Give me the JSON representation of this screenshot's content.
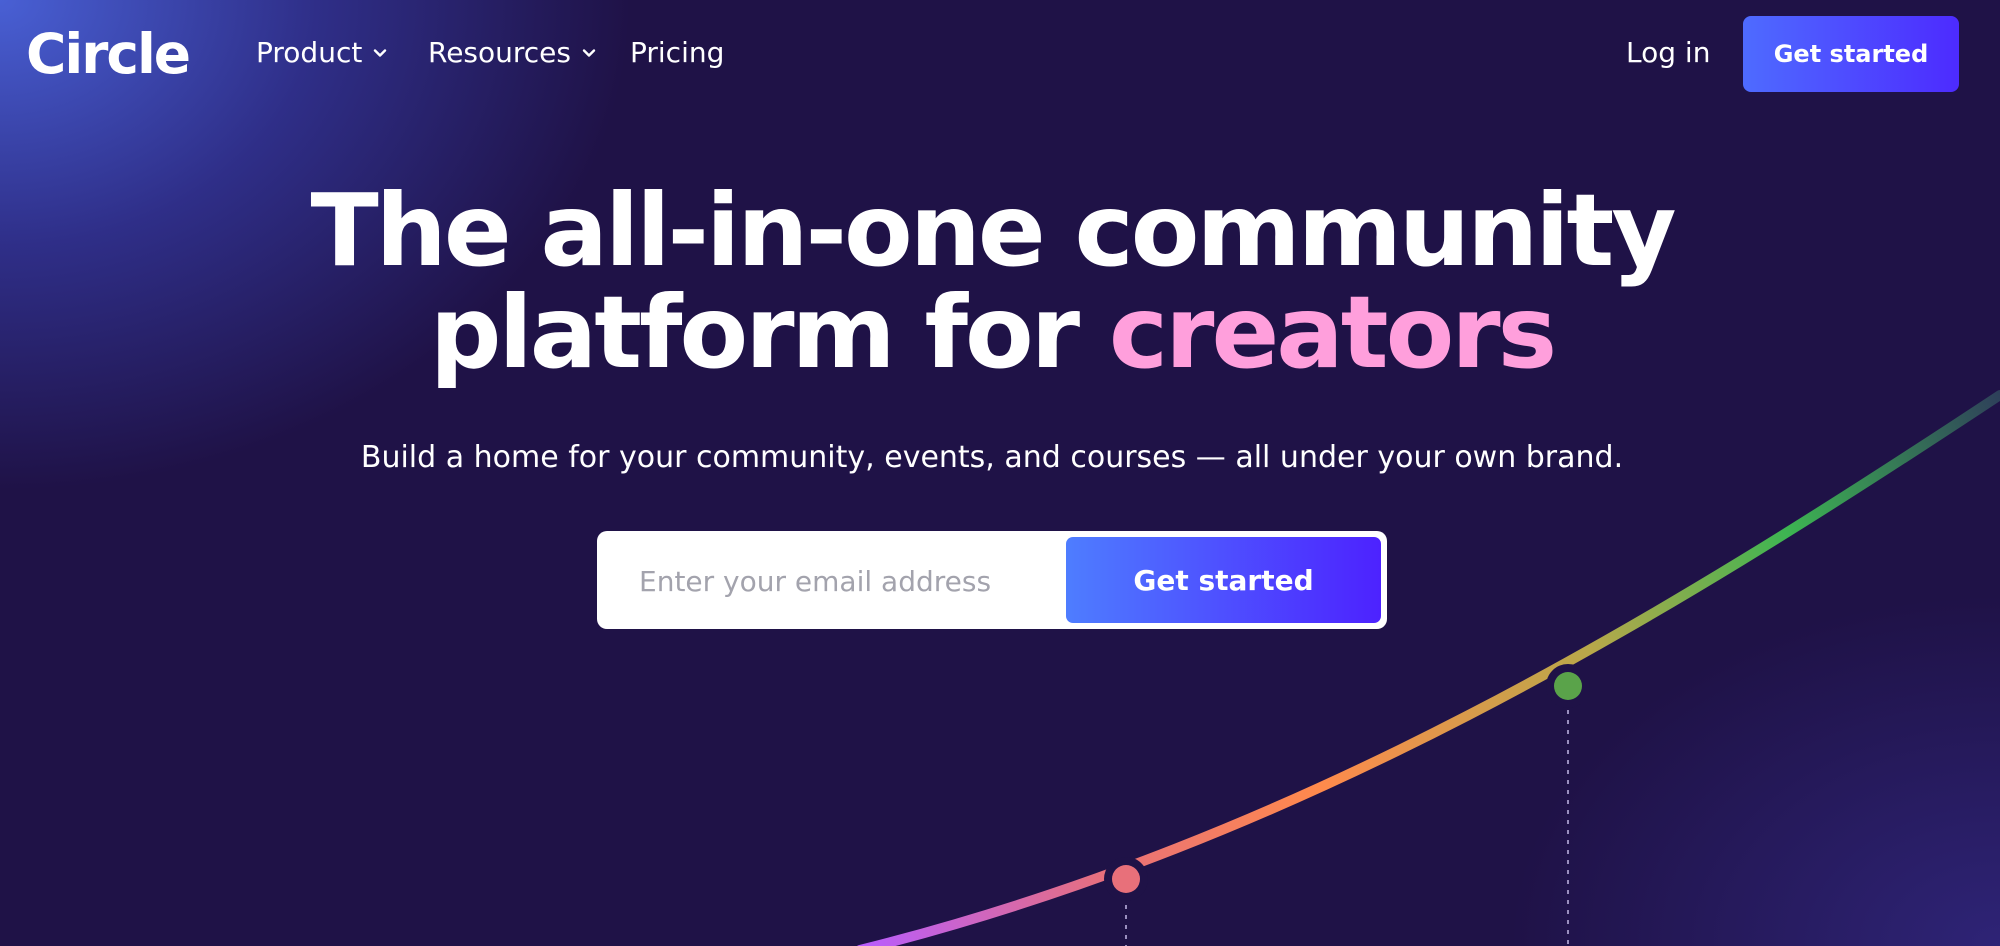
{
  "brand": {
    "logo_text": "Circle"
  },
  "nav": {
    "items": [
      {
        "label": "Product",
        "icon": "chevron-down-icon"
      },
      {
        "label": "Resources",
        "icon": "chevron-down-icon"
      },
      {
        "label": "Pricing"
      }
    ],
    "login_label": "Log in",
    "cta_label": "Get started"
  },
  "hero": {
    "headline_line1": "The all-in-one community",
    "headline_line2_prefix": "platform for ",
    "headline_accent": "creators",
    "subtitle": "Build a home for your community, events, and courses — all under your own brand.",
    "email_placeholder": "Enter your email address",
    "cta_label": "Get started"
  },
  "colors": {
    "background": "#1f1247",
    "accent_pink": "#ff9fdc",
    "button_gradient_start": "#4e7dff",
    "button_gradient_end": "#4d22ff",
    "curve_colors": [
      "#b85cff",
      "#e8707a",
      "#ff8a4c",
      "#b8a84a",
      "#3db552",
      "#2e3f5a"
    ]
  }
}
